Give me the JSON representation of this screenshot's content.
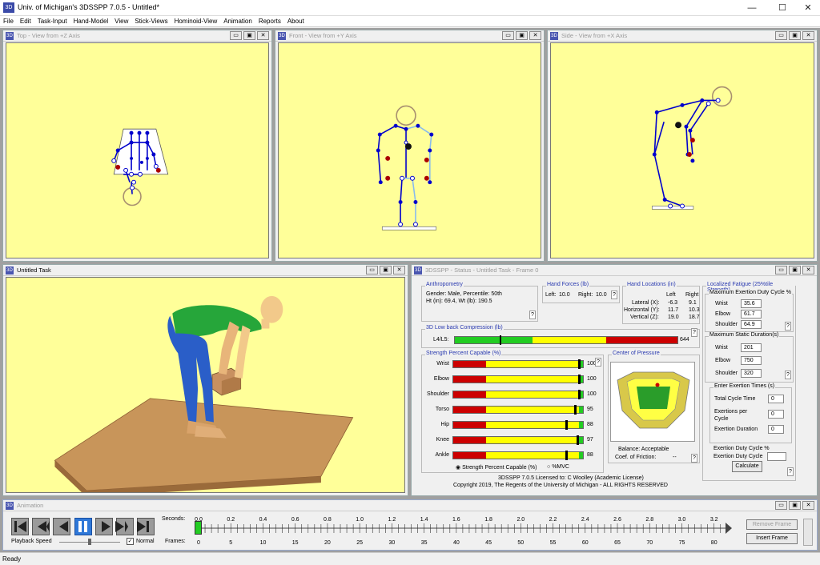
{
  "app": {
    "title": "Univ. of Michigan's 3DSSPP 7.0.5 - Untitled*",
    "icon": "app-icon"
  },
  "window_controls": {
    "minimize": "—",
    "maximize": "☐",
    "close": "✕"
  },
  "menu": [
    "File",
    "Edit",
    "Task-Input",
    "Hand-Model",
    "View",
    "Stick-Views",
    "Hominoid-View",
    "Animation",
    "Reports",
    "About"
  ],
  "views": {
    "top": "Top - View from +Z Axis",
    "front": "Front - View from +Y Axis",
    "side": "Side - View from +X Axis",
    "task": "Untitled Task"
  },
  "mdi_buttons": {
    "min": "▭",
    "max": "▣",
    "close": "✕"
  },
  "status": {
    "title": "3DSSPP - Status - Untitled Task - Frame 0",
    "anthropometry": {
      "label": "Anthropometry",
      "line1": "Gender: Male, Percentile: 50th",
      "line2": "Ht (in): 69.4, Wt (lb): 190.5"
    },
    "hand_forces": {
      "label": "Hand Forces (lb)",
      "left_label": "Left:",
      "left": "10.0",
      "right_label": "Right:",
      "right": "10.0"
    },
    "hand_locations": {
      "label": "Hand Locations (in)",
      "left_header": "Left",
      "right_header": "Right",
      "rows": [
        {
          "name": "Lateral (X):",
          "left": "-6.3",
          "right": "9.1"
        },
        {
          "name": "Horizontal (Y):",
          "left": "11.7",
          "right": "10.3"
        },
        {
          "name": "Vertical (Z):",
          "left": "19.0",
          "right": "18.7"
        }
      ]
    },
    "compression": {
      "label": "3D Low back Compression (lb)",
      "row_label": "L4/L5:",
      "value": "644",
      "fraction": 0.2
    },
    "strength": {
      "label": "Strength Percent Capable (%)",
      "rows": [
        {
          "name": "Wrist",
          "value": "100",
          "pct": 100
        },
        {
          "name": "Elbow",
          "value": "100",
          "pct": 100
        },
        {
          "name": "Shoulder",
          "value": "100",
          "pct": 100
        },
        {
          "name": "Torso",
          "value": "95",
          "pct": 95
        },
        {
          "name": "Hip",
          "value": "88",
          "pct": 88
        },
        {
          "name": "Knee",
          "value": "97",
          "pct": 97
        },
        {
          "name": "Ankle",
          "value": "88",
          "pct": 88
        }
      ],
      "option_spc": "Strength Percent Capable (%)",
      "option_mvc": "%MVC",
      "selected": "Strength Percent Capable (%)"
    },
    "pressure": {
      "label": "Center of Pressure",
      "balance": "Balance: Acceptable",
      "friction_label": "Coef. of Friction:",
      "friction_value": "--"
    },
    "fatigue": {
      "label": "Localized Fatigue (25%tile Strength)",
      "max_duty": {
        "label": "Maximum Exertion Duty Cycle %",
        "rows": [
          {
            "name": "Wrist",
            "value": "35.6"
          },
          {
            "name": "Elbow",
            "value": "61.7"
          },
          {
            "name": "Shoulder",
            "value": "64.9"
          }
        ]
      },
      "max_static": {
        "label": "Maximum Static Duration(s)",
        "rows": [
          {
            "name": "Wrist",
            "value": "201"
          },
          {
            "name": "Elbow",
            "value": "750"
          },
          {
            "name": "Shoulder",
            "value": "320"
          }
        ]
      },
      "exertion_times": {
        "label": "Enter Exertion Times (s)",
        "total_cycle": "Total Cycle Time",
        "total_cycle_value": "0",
        "exertions": "Exertions per Cycle",
        "exertions_value": "0",
        "duration": "Exertion Duration",
        "duration_value": "0"
      },
      "duty_cycle": {
        "label": "Exertion Duty Cycle %",
        "field": "Exertion Duty Cycle",
        "value": ""
      },
      "calculate": "Calculate"
    },
    "license": "3DSSPP 7.0.5 Licensed to: C Woolley (Academic License)",
    "copyright": "Copyright 2019, The Regents of the University of Michigan - ALL RIGHTS RESERVED",
    "help": "?"
  },
  "animation": {
    "title": "Animation",
    "seconds_label": "Seconds:",
    "frames_label": "Frames:",
    "seconds": [
      "0.0",
      "0.2",
      "0.4",
      "0.6",
      "0.8",
      "1.0",
      "1.2",
      "1.4",
      "1.6",
      "1.8",
      "2.0",
      "2.2",
      "2.4",
      "2.6",
      "2.8",
      "3.0",
      "3.2"
    ],
    "frames": [
      "0",
      "5",
      "10",
      "15",
      "20",
      "25",
      "30",
      "35",
      "40",
      "45",
      "50",
      "55",
      "60",
      "65",
      "70",
      "75",
      "80"
    ],
    "playback_label": "Playback Speed",
    "normal_label": "Normal",
    "normal_checked": true,
    "remove_frame": "Remove Frame",
    "insert_frame": "Insert Frame",
    "current_frame": "0"
  },
  "statusbar": "Ready",
  "colors": {
    "viewport": "#ffff99",
    "joint": "#0000cc",
    "force": "#aa0000",
    "skin": "#f2c98a",
    "shirt": "#26a63a",
    "pants": "#2a5ec8",
    "floor": "#c8955a"
  }
}
